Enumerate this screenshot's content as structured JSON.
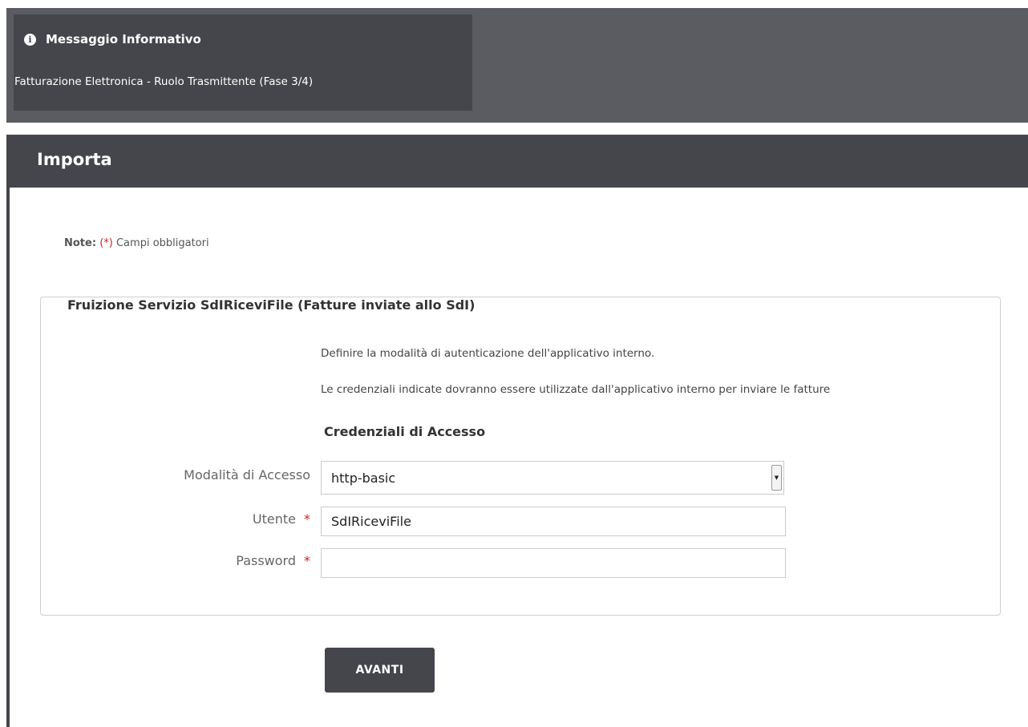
{
  "info": {
    "icon": "info-icon",
    "title": "Messaggio Informativo",
    "text": "Fatturazione Elettronica - Ruolo Trasmittente (Fase 3/4)"
  },
  "section": {
    "title": "Importa"
  },
  "note": {
    "label": "Note:",
    "required_marker": "(*)",
    "text": "Campi obbligatori"
  },
  "fieldset": {
    "legend": "Fruizione Servizio SdIRiceviFile (Fatture inviate allo SdI)",
    "description_1": "Definire la modalità di autenticazione dell'applicativo interno.",
    "description_2": "Le credenziali indicate dovranno essere utilizzate dall'applicativo interno per inviare le fatture",
    "subheading": "Credenziali di Accesso",
    "fields": {
      "modalita": {
        "label": "Modalità di Accesso",
        "value": "http-basic"
      },
      "utente": {
        "label": "Utente",
        "required": "*",
        "value": "SdIRiceviFile"
      },
      "password": {
        "label": "Password",
        "required": "*",
        "value": ""
      }
    }
  },
  "actions": {
    "next_label": "AVANTI"
  },
  "colors": {
    "header_dark": "#45464c",
    "header_band": "#5b5c61",
    "required": "#cc2222"
  }
}
